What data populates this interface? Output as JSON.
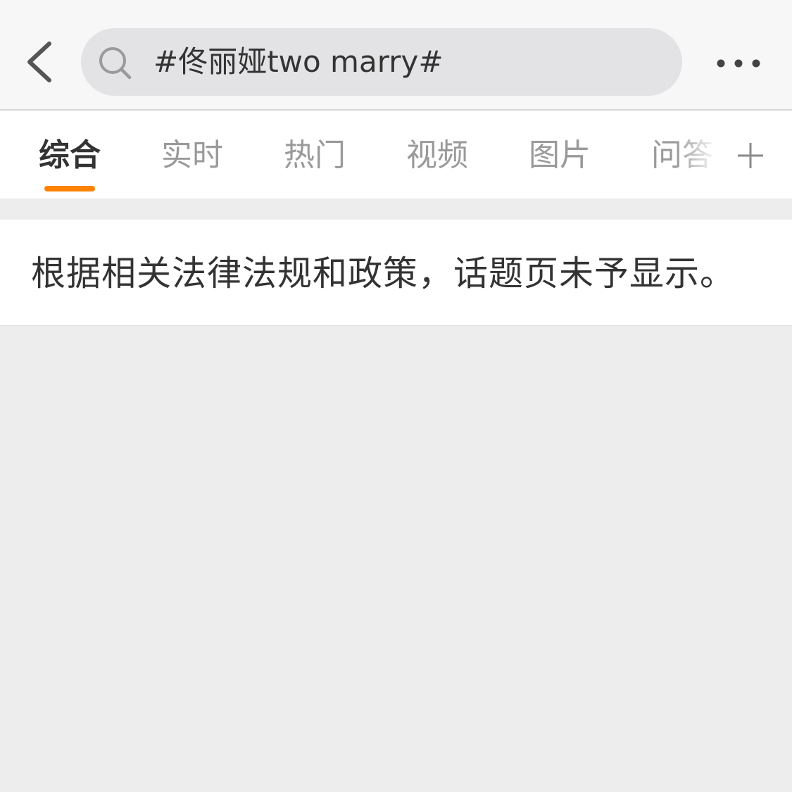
{
  "header": {
    "back_icon": "chevron-left-icon",
    "search_icon": "search-icon",
    "search_query": "#佟丽娅two marry#",
    "more_icon": "more-horizontal-icon"
  },
  "tabs": [
    {
      "label": "综合",
      "active": true
    },
    {
      "label": "实时",
      "active": false
    },
    {
      "label": "热门",
      "active": false
    },
    {
      "label": "视频",
      "active": false
    },
    {
      "label": "图片",
      "active": false
    },
    {
      "label": "问答",
      "active": false
    }
  ],
  "tab_add_icon": "plus-icon",
  "notice": {
    "text": "根据相关法律法规和政策，话题页未予显示。"
  },
  "colors": {
    "accent": "#ff8200",
    "active_tab_text": "#333333",
    "inactive_tab_text": "#9a9a9a",
    "background": "#ededed"
  }
}
